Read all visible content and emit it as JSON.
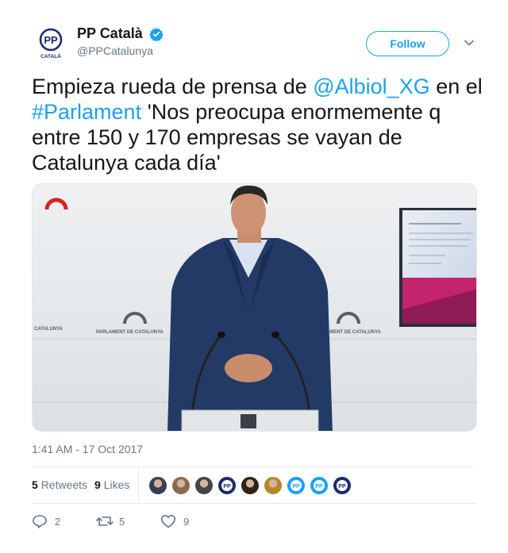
{
  "user": {
    "display_name": "PP Català",
    "handle": "@PPCatalunya",
    "avatar_text": "PP",
    "avatar_subtext": "CATALÀ"
  },
  "follow_label": "Follow",
  "tweet": {
    "parts": [
      {
        "text": "Empieza rueda de prensa de ",
        "link": false
      },
      {
        "text": "@Albiol_XG",
        "link": true
      },
      {
        "text": " en el ",
        "link": false
      },
      {
        "text": "#Parlament",
        "link": true
      },
      {
        "text": " 'Nos preocupa enormemente q entre 150 y 170 empresas se vayan de Catalunya cada día'",
        "link": false
      }
    ]
  },
  "media": {
    "podium_left": "PARLAMENT DE CATALUNYA",
    "podium_right": "PARLAMENT DE CATALUNYA",
    "podium_far_left": "CATALUNYA"
  },
  "timestamp": "1:41 AM - 17 Oct 2017",
  "stats": {
    "retweets_count": "5",
    "retweets_label": "Retweets",
    "likes_count": "9",
    "likes_label": "Likes"
  },
  "likers": [
    {
      "kind": "photo",
      "color": "#3a3f58"
    },
    {
      "kind": "photo",
      "color": "#8a6a55"
    },
    {
      "kind": "photo",
      "color": "#444444"
    },
    {
      "kind": "pp",
      "color": "#1a2a6c"
    },
    {
      "kind": "photo",
      "color": "#2d2416"
    },
    {
      "kind": "photo",
      "color": "#b08a2c"
    },
    {
      "kind": "pp",
      "color": "#1da1f2"
    },
    {
      "kind": "pp",
      "color": "#1da1f2"
    },
    {
      "kind": "pp",
      "color": "#1a2a6c"
    }
  ],
  "actions": {
    "replies": "2",
    "retweets": "5",
    "likes": "9"
  },
  "colors": {
    "link": "#1da1f2",
    "verified": "#1da1f2",
    "pp_blue": "#1a2a6c"
  }
}
